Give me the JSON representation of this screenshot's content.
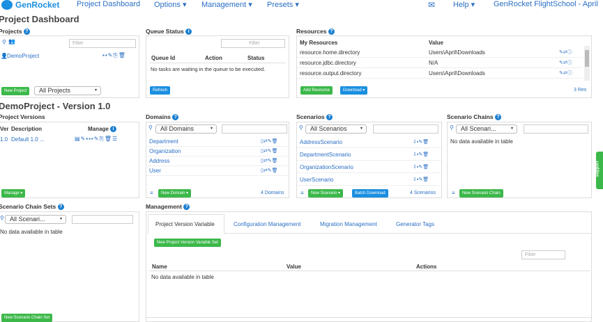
{
  "nav": {
    "brand": "GenRocket",
    "items": [
      "Project Dashboard",
      "Options ▾",
      "Management ▾",
      "Presets ▾"
    ],
    "help": "Help ▾",
    "account": "GenRocket FlightSchool - April"
  },
  "page_title": "Project Dashboard",
  "projects": {
    "title": "Projects",
    "filter_placeholder": "Filter",
    "items": [
      "DemoProject"
    ],
    "new_button": "New Project",
    "scope_select": "All Projects"
  },
  "queue": {
    "title": "Queue Status",
    "filter_placeholder": "Filter",
    "columns": [
      "Queue Id",
      "Action",
      "Status"
    ],
    "empty": "No tasks are waiting in the queue to be executed.",
    "refresh_button": "Refresh"
  },
  "resources": {
    "title": "Resources",
    "columns": [
      "My Resources",
      "Value"
    ],
    "rows": [
      {
        "name": "resource.home.directory",
        "value": "Users\\April\\Downloads"
      },
      {
        "name": "resource.jdbc.directory",
        "value": "N/A"
      },
      {
        "name": "resource.output.directory",
        "value": "Users\\April\\Downloads"
      }
    ],
    "add_button": "Add Resource",
    "download_button": "Download ▾",
    "count": "3 Res"
  },
  "version": {
    "title": "DemoProject - Version 1.0",
    "subtitle": "Project Versions",
    "columns": [
      "Ver",
      "Description",
      "Manage"
    ],
    "rows": [
      {
        "ver": "1.0",
        "desc": "Default 1.0 ..."
      }
    ],
    "manage_button": "Manage ▾"
  },
  "domains": {
    "title": "Domains",
    "select": "All Domains",
    "items": [
      "Department",
      "Organization",
      "Address",
      "User"
    ],
    "new_button": "New Domain ▾",
    "count": "4 Domains"
  },
  "scenarios": {
    "title": "Scenarios",
    "select": "All Scenarios",
    "items": [
      "AddressScenario",
      "DepartmentScenario",
      "OrganizationScenario",
      "UserScenario"
    ],
    "new_button": "New Scenario ▾",
    "batch_button": "Batch Download",
    "count": "4 Scenarios"
  },
  "chains": {
    "title": "Scenario Chains",
    "select": "All Scenari...",
    "empty": "No data available in table",
    "new_button": "New Scenario Chain"
  },
  "chain_sets": {
    "title": "Scenario Chain Sets",
    "select": "All Scenari...",
    "empty": "No data available in table",
    "new_button": "New Scenario Chain Set"
  },
  "management": {
    "title": "Management",
    "tabs": [
      "Project Version Variable",
      "Configuration Management",
      "Migration Management",
      "Generator Tags"
    ],
    "new_button": "New Project Version Variable Set",
    "filter_placeholder": "Filter",
    "columns": [
      "Name",
      "Value",
      "Actions"
    ],
    "empty": "No data available in table"
  },
  "support": "Support"
}
